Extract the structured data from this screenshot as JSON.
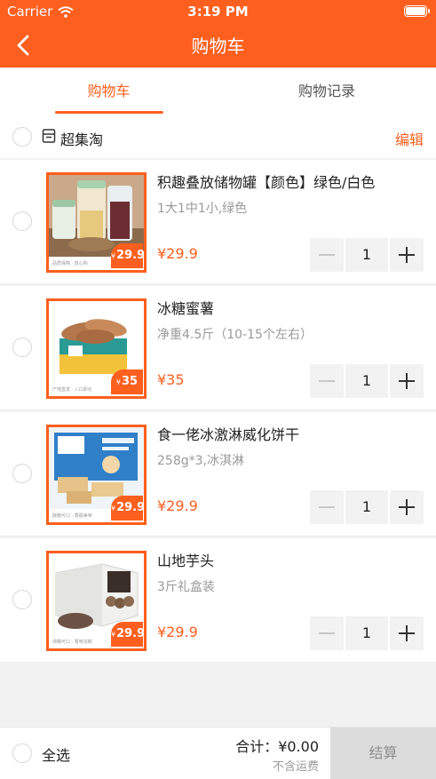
{
  "status_bar": {
    "carrier": "Carrier",
    "time": "3:19 PM"
  },
  "nav": {
    "title": "购物车",
    "back_icon": "chevron-left-icon"
  },
  "tabs": [
    {
      "label": "购物车",
      "active": true
    },
    {
      "label": "购物记录",
      "active": false
    }
  ],
  "shop": {
    "name": "超集淘",
    "edit_label": "编辑",
    "icon": "store-icon"
  },
  "items": [
    {
      "name": "积趣叠放储物罐【颜色】绿色/白色",
      "spec": "1大1中1小,绿色",
      "price": "¥29.9",
      "quantity": "1",
      "thumb_price": "29.9",
      "thumb_caption": "品质保障 · 放心购"
    },
    {
      "name": "冰糖蜜薯",
      "spec": "净重4.5斤（10-15个左右）",
      "price": "¥35",
      "quantity": "1",
      "thumb_price": "35",
      "thumb_caption": "产地直发 · 入口即化"
    },
    {
      "name": "食一佬冰激淋威化饼干",
      "spec": "258g*3,冰淇淋",
      "price": "¥29.9",
      "quantity": "1",
      "thumb_price": "29.9",
      "thumb_caption": "酥脆可口 · 香甜美味"
    },
    {
      "name": "山地芋头",
      "spec": "3斤礼盒装",
      "price": "¥29.9",
      "quantity": "1",
      "thumb_price": "29.9",
      "thumb_caption": "绵糯可口 · 香味浓郁"
    }
  ],
  "footer": {
    "select_all_label": "全选",
    "total_text": "合计：¥0.00",
    "shipping_note": "不含运费",
    "checkout_label": "结算"
  },
  "colors": {
    "accent": "#fd5f1e",
    "checkout_disabled": "#dcdcdc",
    "page_bg": "#f2f2f2"
  }
}
